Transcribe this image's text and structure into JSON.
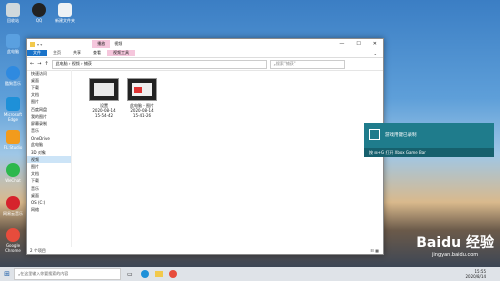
{
  "desktop": {
    "icons": [
      {
        "label": "回收站",
        "icon": "recycle-bin-icon",
        "color": "#cfd8dc"
      },
      {
        "label": "QQ",
        "icon": "qq-icon",
        "color": "#222"
      },
      {
        "label": "新建文件夹",
        "icon": "file-icon",
        "color": "#eef2f5"
      },
      {
        "label": "此电脑",
        "icon": "computer-icon",
        "color": "#5aa0e0"
      },
      {
        "label": "酷狗音乐",
        "icon": "music-icon",
        "color": "#2f8ae0"
      },
      {
        "label": "Microsoft Edge",
        "icon": "edge-icon",
        "color": "#1e90d8"
      },
      {
        "label": "FL Studio",
        "icon": "fl-studio-icon",
        "color": "#f29b1c"
      },
      {
        "label": "WeChat",
        "icon": "wechat-icon",
        "color": "#2db84d"
      },
      {
        "label": "网易云音乐",
        "icon": "netease-icon",
        "color": "#d6232c"
      },
      {
        "label": "Google Chrome",
        "icon": "chrome-icon",
        "color": "#e74c3c"
      }
    ]
  },
  "explorer": {
    "tab_label": "播放",
    "window_title": "视频",
    "ribbon_tabs": [
      "文件",
      "主页",
      "共享",
      "查看",
      "视频工具"
    ],
    "address_path": "此电脑 › 视频 › 捕获",
    "search_placeholder": "搜索\"捕获\"",
    "nav_items": [
      {
        "label": "快速访问",
        "selected": false
      },
      {
        "label": "桌面",
        "selected": false
      },
      {
        "label": "下载",
        "selected": false
      },
      {
        "label": "文档",
        "selected": false
      },
      {
        "label": "图片",
        "selected": false
      },
      {
        "label": "百度网盘",
        "selected": false
      },
      {
        "label": "我的图片",
        "selected": false
      },
      {
        "label": "屏幕录制",
        "selected": false
      },
      {
        "label": "音乐",
        "selected": false
      },
      {
        "label": "OneDrive",
        "selected": false
      },
      {
        "label": "此电脑",
        "selected": false
      },
      {
        "label": "3D 对象",
        "selected": false
      },
      {
        "label": "视频",
        "selected": true
      },
      {
        "label": "图片",
        "selected": false
      },
      {
        "label": "文档",
        "selected": false
      },
      {
        "label": "下载",
        "selected": false
      },
      {
        "label": "音乐",
        "selected": false
      },
      {
        "label": "桌面",
        "selected": false
      },
      {
        "label": "OS (C:)",
        "selected": false
      },
      {
        "label": "网络",
        "selected": false
      }
    ],
    "files": [
      {
        "name": "设置",
        "line2": "2020-08-14",
        "line3": "15-54-42"
      },
      {
        "name": "此电脑 - 图片",
        "line2": "2020-08-14",
        "line3": "15-41-26"
      }
    ],
    "status": "2 个项目"
  },
  "notification": {
    "title": "游戏用键已录制",
    "subtitle": "按 ⊞+G 打开 Xbox Game Bar",
    "accent": "#1f7c8c"
  },
  "taskbar": {
    "search_placeholder": "在这里输入你要搜索的内容",
    "clock_time": "15:55",
    "clock_date": "2020/8/14",
    "watermark": "Baidu 经验",
    "watermark_url": "jingyan.baidu.com"
  }
}
